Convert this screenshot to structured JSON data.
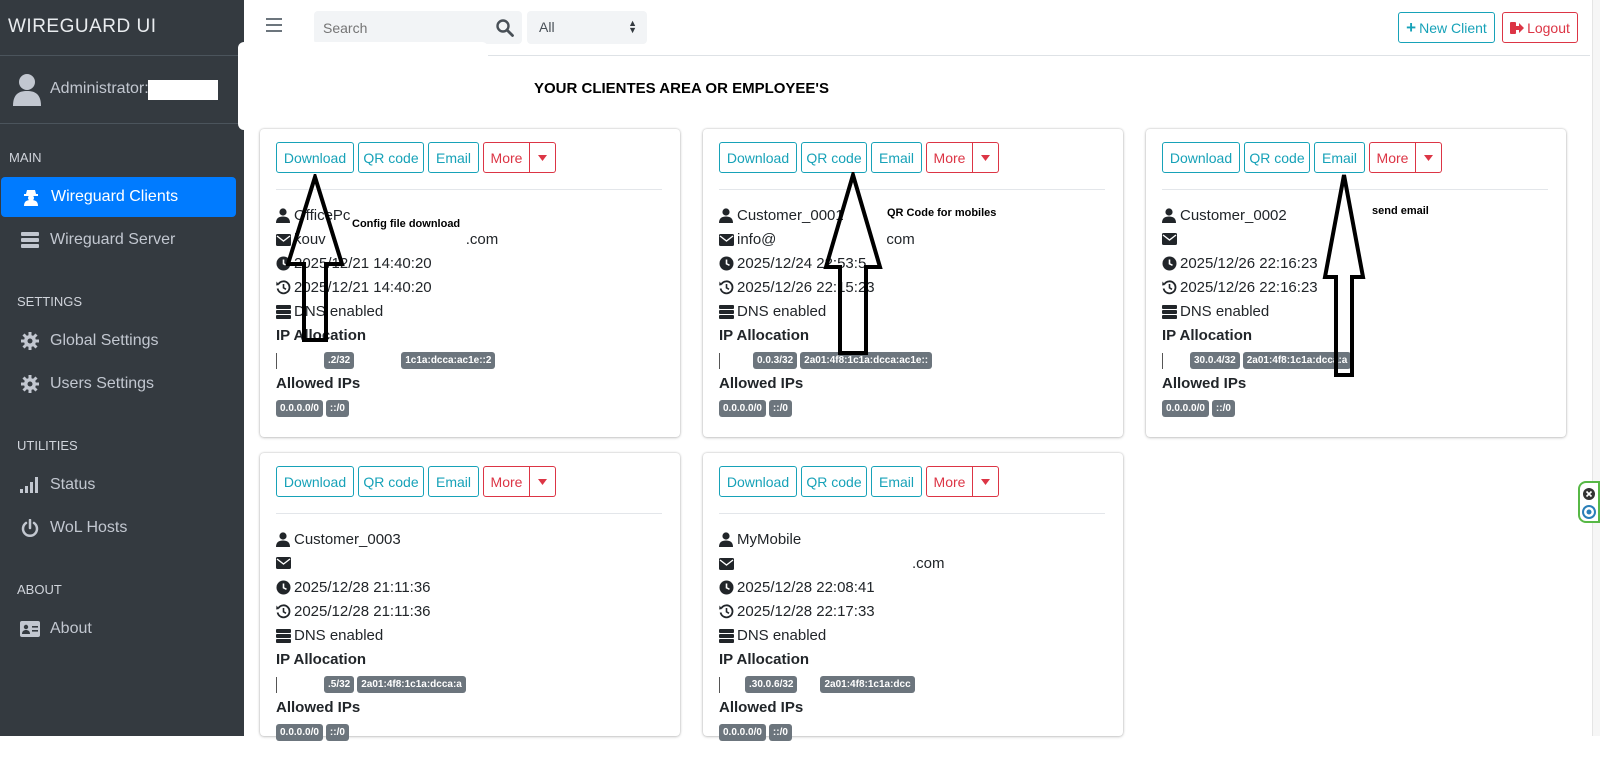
{
  "brand": "WIREGUARD UI",
  "user": {
    "label": "Administrator:"
  },
  "nav": {
    "main_header": "MAIN",
    "wireguard_clients": "Wireguard Clients",
    "wireguard_server": "Wireguard Server",
    "settings_header": "SETTINGS",
    "global_settings": "Global Settings",
    "users_settings": "Users Settings",
    "utilities_header": "UTILITIES",
    "status": "Status",
    "wol_hosts": "WoL Hosts",
    "about_header": "ABOUT",
    "about": "About"
  },
  "topbar": {
    "search_placeholder": "Search",
    "filter_value": "All",
    "new_client": "New Client",
    "logout": "Logout"
  },
  "heading": "YOUR CLIENTES AREA OR EMPLOYEE'S",
  "buttons": {
    "download": "Download",
    "qr": "QR code",
    "email": "Email",
    "more": "More"
  },
  "labels": {
    "ip_allocation": "IP Allocation",
    "allowed_ips": "Allowed IPs",
    "dns": "DNS enabled"
  },
  "clients": [
    {
      "name": "OfficePc",
      "email_visible": "kouv",
      "email_suffix": ".com",
      "created": "2025/12/21 14:40:20",
      "updated": "2025/12/21 14:40:20",
      "ip_v4": ".2/32",
      "ip_v6": "1c1a:dcca:ac1e::2",
      "allowed": [
        "0.0.0.0/0",
        "::/0"
      ]
    },
    {
      "name": "Customer_0001",
      "email_visible": "info@",
      "email_suffix": "com",
      "created": "2025/12/24 22:53:5",
      "updated": "2025/12/26 22:15:23",
      "ip_v4": "0.0.3/32",
      "ip_v6": "2a01:4f8:1c1a:dcca:ac1e::",
      "allowed": [
        "0.0.0.0/0",
        "::/0"
      ]
    },
    {
      "name": "Customer_0002",
      "email_visible": "",
      "email_suffix": "",
      "created": "2025/12/26 22:16:23",
      "updated": "2025/12/26 22:16:23",
      "ip_v4": "30.0.4/32",
      "ip_v6": "2a01:4f8:1c1a:dcca:a",
      "allowed": [
        "0.0.0.0/0",
        "::/0"
      ]
    },
    {
      "name": "Customer_0003",
      "email_visible": "",
      "email_suffix": "",
      "created": "2025/12/28 21:11:36",
      "updated": "2025/12/28 21:11:36",
      "ip_v4": ".5/32",
      "ip_v6": "2a01:4f8:1c1a:dcca:a",
      "allowed": [
        "0.0.0.0/0",
        "::/0"
      ]
    },
    {
      "name": "MyMobile",
      "email_visible": "",
      "email_suffix": ".com",
      "created": "2025/12/28 22:08:41",
      "updated": "2025/12/28 22:17:33",
      "ip_v4": ".30.0.6/32",
      "ip_v6": "2a01:4f8:1c1a:dcc",
      "allowed": [
        "0.0.0.0/0",
        "::/0"
      ]
    }
  ],
  "annotations": {
    "download": "Config file download",
    "qr": "QR Code for mobiles",
    "email": "send email"
  }
}
